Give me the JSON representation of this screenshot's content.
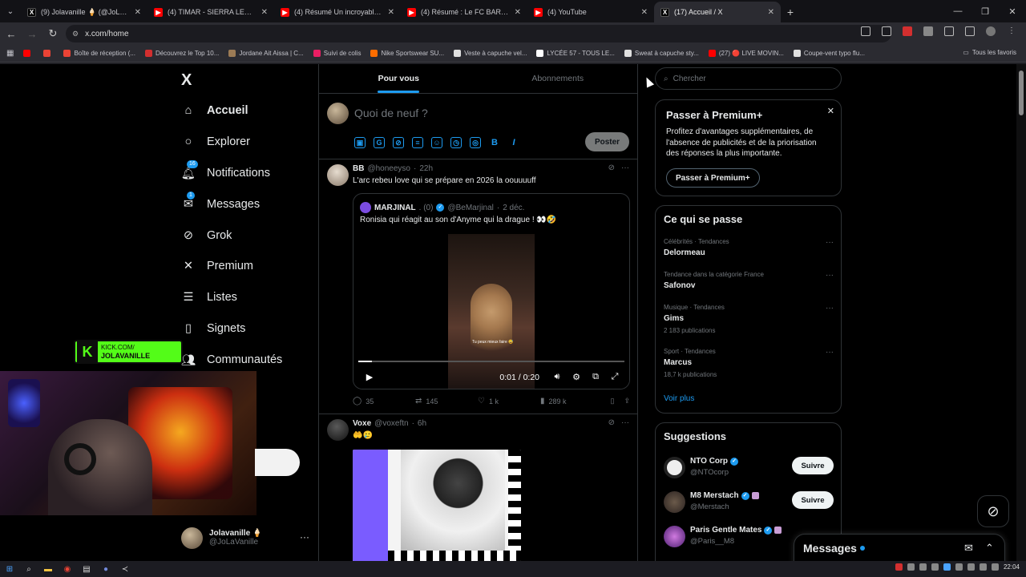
{
  "browser": {
    "tabs": [
      {
        "title": "(9) Jolavanille 🍦 (@JoLaVanille)",
        "favicon": "x-icon",
        "active": false
      },
      {
        "title": "(4) TIMAR - SIERRA LEONE - YouTube",
        "favicon": "youtube-icon",
        "active": false
      },
      {
        "title": "(4) Résumé Un incroyable Mbappé",
        "favicon": "youtube-icon",
        "active": false
      },
      {
        "title": "(4) Résumé : Le FC BARCELONE",
        "favicon": "youtube-icon",
        "active": false
      },
      {
        "title": "(4) YouTube",
        "favicon": "youtube-icon",
        "active": false
      },
      {
        "title": "(17) Accueil / X",
        "favicon": "x-icon",
        "active": true
      }
    ],
    "new_tab": "+",
    "url": "x.com/home",
    "bookmarks": [
      {
        "label": "",
        "color": "#ff0000"
      },
      {
        "label": "",
        "color": "#ea4335"
      },
      {
        "label": "Boîte de réception (...",
        "color": "#ea4335"
      },
      {
        "label": "Découvrez le Top 10...",
        "color": "#d32f2f"
      },
      {
        "label": "Jordane Ait Aissa | C...",
        "color": "#9c7b55"
      },
      {
        "label": "Suivi de colis",
        "color": "#e91e63"
      },
      {
        "label": "Nike Sportswear SU...",
        "color": "#ff6d00"
      },
      {
        "label": "Veste à capuche vel...",
        "color": "#e0e0e0"
      },
      {
        "label": "LYCÉE 57 - TOUS LE...",
        "color": "#ffffff"
      },
      {
        "label": "Sweat à capuche sty...",
        "color": "#e0e0e0"
      },
      {
        "label": "(27) 🔴 LIVE MOVIN...",
        "color": "#ff0000"
      },
      {
        "label": "Coupe-vent typo flu...",
        "color": "#e0e0e0"
      }
    ],
    "all_bookmarks": "Tous les favoris"
  },
  "nav": {
    "logo": "X",
    "items": [
      {
        "label": "Accueil",
        "icon": "home-icon",
        "badge": ""
      },
      {
        "label": "Explorer",
        "icon": "search-icon",
        "badge": ""
      },
      {
        "label": "Notifications",
        "icon": "bell-icon",
        "badge": "16"
      },
      {
        "label": "Messages",
        "icon": "mail-icon",
        "badge": "1"
      },
      {
        "label": "Grok",
        "icon": "grok-icon",
        "badge": ""
      },
      {
        "label": "Premium",
        "icon": "x-premium-icon",
        "badge": ""
      },
      {
        "label": "Listes",
        "icon": "list-icon",
        "badge": ""
      },
      {
        "label": "Signets",
        "icon": "bookmark-icon",
        "badge": ""
      },
      {
        "label": "Communautés",
        "icon": "communities-icon",
        "badge": ""
      }
    ],
    "profile": {
      "name": "Jolavanille 🍦",
      "handle": "@JoLaVanille"
    }
  },
  "overlay": {
    "kick_line1": "KICK.COM/",
    "kick_line2": "JOLAVANILLE"
  },
  "feed": {
    "tabs": [
      {
        "label": "Pour vous"
      },
      {
        "label": "Abonnements"
      }
    ],
    "compose_placeholder": "Quoi de neuf ?",
    "post_button": "Poster",
    "tweets": [
      {
        "name": "BB",
        "handle": "@honeeyso",
        "time": "22h",
        "text": "L'arc rebeu love qui se prépare en 2026 la oouuuuff",
        "quote": {
          "name": "MARJINAL",
          "name_suffix": ". (0)",
          "handle": "@BeMarjinal",
          "time": "2 déc.",
          "text": "Ronisia qui réagit au son d'Anyme qui la drague ! 👀🤣",
          "video_caption": "Tu peux mieux faire 😅",
          "video_time": "0:01 / 0:20",
          "video_progress": 0.05
        },
        "replies": "35",
        "reposts": "145",
        "likes": "1 k",
        "views": "289 k"
      },
      {
        "name": "Voxe",
        "handle": "@voxeftn",
        "time": "6h",
        "text": "🤲🥲"
      }
    ]
  },
  "sidebar": {
    "search_placeholder": "Chercher",
    "premium": {
      "title": "Passer à Premium+",
      "description": "Profitez d'avantages supplémentaires, de l'absence de publicités et de la priorisation des réponses la plus importante.",
      "button": "Passer à Premium+"
    },
    "trends_title": "Ce qui se passe",
    "trends": [
      {
        "category": "Célébrités · Tendances",
        "name": "Delormeau",
        "count": ""
      },
      {
        "category": "Tendance dans la catégorie France",
        "name": "Safonov",
        "count": ""
      },
      {
        "category": "Musique · Tendances",
        "name": "Gims",
        "count": "2 183 publications"
      },
      {
        "category": "Sport · Tendances",
        "name": "Marcus",
        "count": "18,7 k publications"
      }
    ],
    "see_more": "Voir plus",
    "suggestions_title": "Suggestions",
    "suggestions": [
      {
        "name": "NTO Corp",
        "handle": "@NTOcorp",
        "button": "Suivre"
      },
      {
        "name": "M8 Merstach",
        "handle": "@Merstach",
        "button": "Suivre"
      },
      {
        "name": "Paris Gentle Mates",
        "handle": "@Paris__M8",
        "button": ""
      }
    ]
  },
  "messages_dock": {
    "title": "Messages"
  },
  "taskbar": {
    "time": "22:04"
  },
  "colors": {
    "accent": "#1d9bf0",
    "kick": "#53fc18"
  }
}
